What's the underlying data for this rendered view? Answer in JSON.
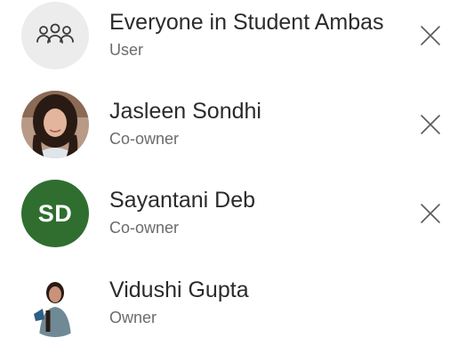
{
  "members": [
    {
      "name": "Everyone in Student Ambas",
      "role": "User",
      "avatar": "group-icon",
      "removable": true
    },
    {
      "name": "Jasleen Sondhi",
      "role": "Co-owner",
      "avatar": "photo",
      "removable": true
    },
    {
      "name": "Sayantani Deb",
      "role": "Co-owner",
      "avatar": "initials",
      "initials": "SD",
      "removable": true
    },
    {
      "name": "Vidushi Gupta",
      "role": "Owner",
      "avatar": "photo",
      "removable": false
    }
  ],
  "colors": {
    "initials_avatar_bg": "#2f6e2f",
    "group_avatar_bg": "#ececec",
    "remove_icon": "#5a5a5a"
  },
  "icons": {
    "group": "people-group-icon",
    "remove": "close-icon"
  }
}
